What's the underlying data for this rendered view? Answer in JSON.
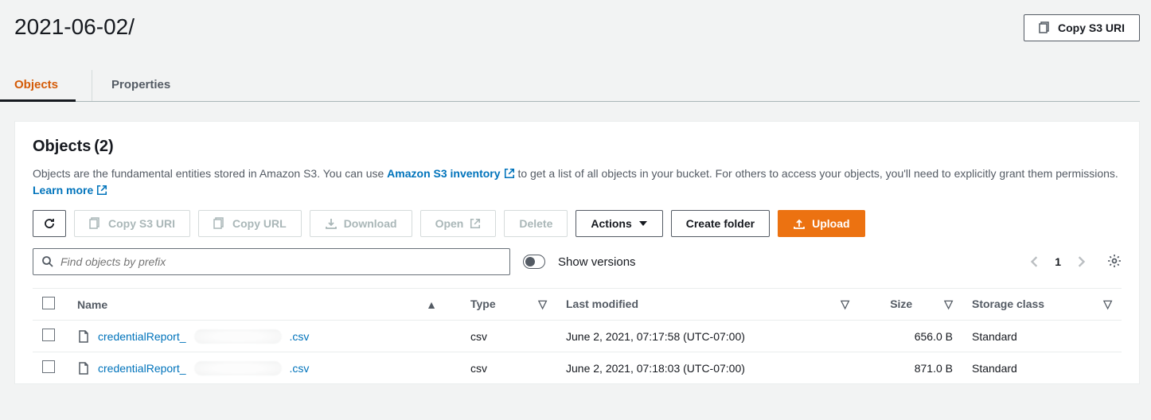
{
  "page_title": "2021-06-02/",
  "header_button": "Copy S3 URI",
  "tabs": {
    "objects": "Objects",
    "properties": "Properties"
  },
  "panel": {
    "heading": "Objects",
    "count": "(2)",
    "desc_pre": "Objects are the fundamental entities stored in Amazon S3. You can use ",
    "link_inventory": "Amazon S3 inventory",
    "desc_mid": " to get a list of all objects in your bucket. For others to access your objects, you'll need to explicitly grant them permissions. ",
    "link_learn": "Learn more"
  },
  "toolbar": {
    "copy_s3": "Copy S3 URI",
    "copy_url": "Copy URL",
    "download": "Download",
    "open": "Open",
    "delete": "Delete",
    "actions": "Actions",
    "create_folder": "Create folder",
    "upload": "Upload"
  },
  "search": {
    "placeholder": "Find objects by prefix"
  },
  "show_versions": "Show versions",
  "pager": {
    "current": "1"
  },
  "columns": {
    "name": "Name",
    "type": "Type",
    "last_modified": "Last modified",
    "size": "Size",
    "storage_class": "Storage class"
  },
  "rows": [
    {
      "name_prefix": "credentialReport_",
      "name_suffix": ".csv",
      "type": "csv",
      "last_modified": "June 2, 2021, 07:17:58 (UTC-07:00)",
      "size": "656.0 B",
      "storage_class": "Standard"
    },
    {
      "name_prefix": "credentialReport_",
      "name_suffix": ".csv",
      "type": "csv",
      "last_modified": "June 2, 2021, 07:18:03 (UTC-07:00)",
      "size": "871.0 B",
      "storage_class": "Standard"
    }
  ]
}
